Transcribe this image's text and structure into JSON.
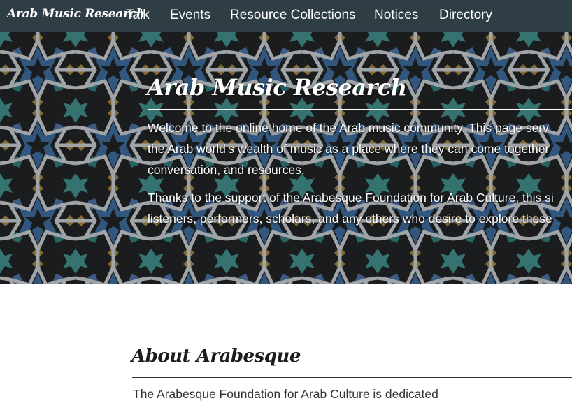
{
  "nav": {
    "brand": "Arab Music Research",
    "items": [
      "Talk",
      "Events",
      "Resource Collections",
      "Notices",
      "Directory"
    ]
  },
  "hero": {
    "title": "Arab Music Research",
    "paragraph1_lines": [
      "Welcome to the online home of the Arab music community. This page serv",
      "the Arab world's wealth of music as a place where they can come together",
      "conversation, and resources."
    ],
    "paragraph2_lines": [
      "Thanks to the support of the Arabesque Foundation for Arab Culture, this si",
      "listeners, performers, scholars, and any others who desire to explore these"
    ]
  },
  "about": {
    "title": "About Arabesque",
    "text": "The Arabesque Foundation for Arab Culture is dedicated"
  },
  "colors": {
    "navbar": "#2f3e45",
    "tile_blue": "#3d6b9c",
    "tile_teal": "#3f8f8a",
    "tile_ochre": "#a8853f",
    "tile_dark": "#1e1f21"
  }
}
